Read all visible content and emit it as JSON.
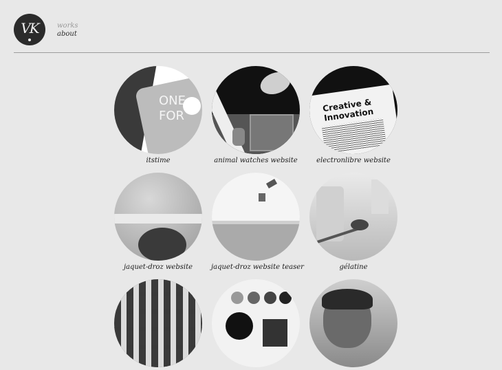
{
  "logo": {
    "text": "VK"
  },
  "nav": {
    "works": "works",
    "about": "about"
  },
  "works": [
    {
      "title": "itstime",
      "thumb_text": "ONE\nFOR"
    },
    {
      "title": "animal watches website"
    },
    {
      "title": "electronlibre website",
      "thumb_text": "Creative &\nInnovation"
    },
    {
      "title": "jaquet-droz website"
    },
    {
      "title": "jaquet-droz website teaser"
    },
    {
      "title": "gélatine"
    },
    {
      "title": ""
    },
    {
      "title": ""
    },
    {
      "title": ""
    }
  ]
}
